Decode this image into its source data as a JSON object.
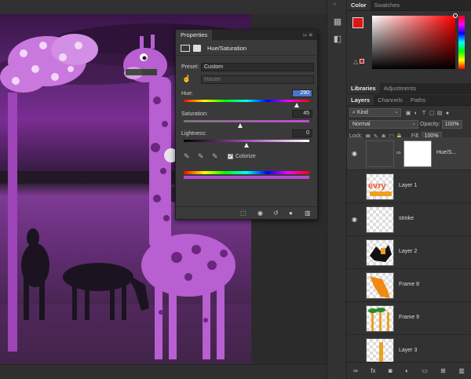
{
  "color_panel": {
    "tabs": [
      "Color",
      "Swatches"
    ],
    "foreground_color": "#e01414"
  },
  "adjust_tabs": [
    "Libraries",
    "Adjustments"
  ],
  "layers_panel": {
    "tabs": [
      "Layers",
      "Channels",
      "Paths"
    ],
    "kind_label": "Kind",
    "blend_mode": "Normal",
    "opacity_label": "Opacity:",
    "opacity_value": "100%",
    "lock_label": "Lock:",
    "fill_label": "Fill:",
    "fill_value": "100%",
    "layers": [
      {
        "name": "Hue/S...",
        "visible": true,
        "type": "adjustment"
      },
      {
        "name": "Layer 1",
        "visible": false,
        "type": "pixel"
      },
      {
        "name": "stroke",
        "visible": true,
        "type": "pixel"
      },
      {
        "name": "Layer 2",
        "visible": false,
        "type": "pixel"
      },
      {
        "name": "Frame 8",
        "visible": false,
        "type": "pixel"
      },
      {
        "name": "Frame 9",
        "visible": false,
        "type": "pixel"
      },
      {
        "name": "Layer 3",
        "visible": false,
        "type": "pixel"
      }
    ]
  },
  "properties": {
    "tab": "Properties",
    "title": "Hue/Saturation",
    "preset_label": "Preset:",
    "preset_value": "Custom",
    "channel_value": "Master",
    "hue_label": "Hue:",
    "hue_value": "290",
    "hue_fraction": 0.903,
    "saturation_label": "Saturation:",
    "saturation_value": "45",
    "saturation_fraction": 0.45,
    "lightness_label": "Lightness:",
    "lightness_value": "0",
    "lightness_fraction": 0.5,
    "colorize_label": "Colorize",
    "colorize_checked": true
  }
}
